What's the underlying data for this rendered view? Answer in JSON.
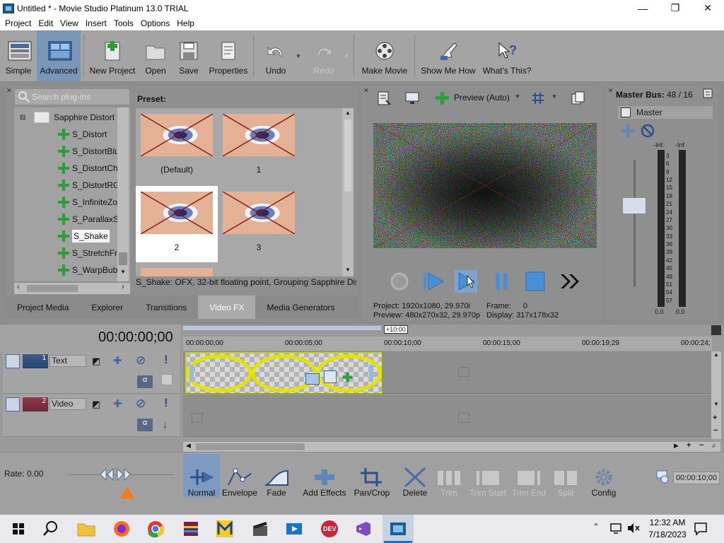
{
  "window": {
    "title": "Untitled * - Movie Studio Platinum 13.0 TRIAL",
    "minimize": "—",
    "maximize": "❐",
    "close": "✕"
  },
  "menu": [
    "Project",
    "Edit",
    "View",
    "Insert",
    "Tools",
    "Options",
    "Help"
  ],
  "toolbar": {
    "simple": "Simple",
    "advanced": "Advanced",
    "new_project": "New Project",
    "open": "Open",
    "save": "Save",
    "properties": "Properties",
    "undo": "Undo",
    "redo": "Redo",
    "make_movie": "Make Movie",
    "show_me_how": "Show Me How",
    "whats_this": "What's This?"
  },
  "plugins": {
    "search_placeholder": "Search plug-ins",
    "tree": [
      "Sapphire Distort",
      "S_Distort",
      "S_DistortBlur",
      "S_DistortChr",
      "S_DistortRGB",
      "S_InfiniteZoo",
      "S_ParallaxStr",
      "S_Shake",
      "S_StretchFra",
      "S_WarpBubb"
    ],
    "selected": "S_Shake"
  },
  "presets": {
    "label": "Preset:",
    "items": [
      "(Default)",
      "1",
      "2",
      "3"
    ],
    "selected": "2",
    "status": "S_Shake: OFX, 32-bit floating point, Grouping  Sapphire Distort,"
  },
  "tabs": [
    "Project Media",
    "Explorer",
    "Transitions",
    "Video FX",
    "Media Generators"
  ],
  "active_tab": "Video FX",
  "preview": {
    "mode": "Preview (Auto)",
    "project_label": "Project:",
    "project_value": "1920x1080, 29.970i",
    "preview_label": "Preview:",
    "preview_value": "480x270x32, 29.970p",
    "frame_label": "Frame:",
    "frame_value": "0",
    "display_label": "Display:",
    "display_value": "317x178x32"
  },
  "master": {
    "title": "Master Bus:",
    "count": "48 / 16",
    "name": "Master",
    "inf_left": "-Inf.",
    "inf_right": "-Inf.",
    "scale": [
      "3",
      "6",
      "9",
      "12",
      "15",
      "18",
      "21",
      "24",
      "27",
      "30",
      "33",
      "36",
      "39",
      "42",
      "45",
      "48",
      "51",
      "54",
      "57"
    ],
    "zero_left": "0.0",
    "zero_right": "0.0"
  },
  "timeline": {
    "timecode": "00:00:00;00",
    "offset": "+10:00",
    "ruler": [
      "00:00:00;00",
      "00:00:05;00",
      "00:00:10;00",
      "00:00:15;00",
      "00:00:19;29",
      "00:00:24;"
    ],
    "tracks": [
      {
        "number": "1",
        "name": "Text"
      },
      {
        "number": "2",
        "name": "Video"
      }
    ],
    "rate_label": "Rate: 0.00"
  },
  "edit_toolbar": {
    "normal": "Normal",
    "envelope": "Envelope",
    "fade": "Fade",
    "add_effects": "Add Effects",
    "pan_crop": "Pan/Crop",
    "delete": "Delete",
    "trim": "Trim",
    "trim_start": "Trim Start",
    "trim_end": "Trim End",
    "split": "Split",
    "config": "Config",
    "duration": "00:00:10;00"
  },
  "taskbar": {
    "time": "12:32 AM",
    "date": "7/18/2023"
  }
}
